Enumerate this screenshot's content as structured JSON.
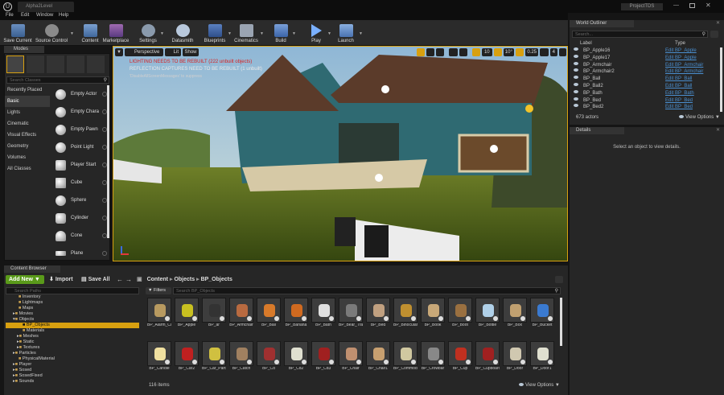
{
  "app": {
    "level_tab": "Alpha2Level",
    "project": "ProjectTDS",
    "menu": [
      "File",
      "Edit",
      "Window",
      "Help"
    ]
  },
  "toolbar": {
    "save": "Save Current",
    "source_control": "Source Control",
    "content": "Content",
    "marketplace": "Marketplace",
    "settings": "Settings",
    "datasmith": "Datasmith",
    "blueprints": "Blueprints",
    "cinematics": "Cinematics",
    "build": "Build",
    "play": "Play",
    "launch": "Launch"
  },
  "modes": {
    "tab": "Modes",
    "search_placeholder": "Search Classes",
    "categories": [
      "Recently Placed",
      "Basic",
      "Lights",
      "Cinematic",
      "Visual Effects",
      "Geometry",
      "Volumes",
      "All Classes"
    ],
    "selected_category": "Basic",
    "classes": [
      "Empty Actor",
      "Empty Chara",
      "Empty Pawn",
      "Point Light",
      "Player Start",
      "Cube",
      "Sphere",
      "Cylinder",
      "Cone",
      "Plane"
    ]
  },
  "viewport": {
    "perspective": "Perspective",
    "lit": "Lit",
    "show": "Show",
    "warning1": "LIGHTING NEEDS TO BE REBUILT (222 unbuilt objects)",
    "warning2": "REFLECTION CAPTURES NEED TO BE REBUILT (1 unbuilt)",
    "warning3": "'DisableAllScreenMessages' to suppress",
    "grid_snap": "10",
    "rot_snap": "10°",
    "scale_snap": "0.25",
    "cam_speed": "4"
  },
  "outliner": {
    "tab": "World Outliner",
    "search_placeholder": "Search...",
    "col_label": "Label",
    "col_type": "Type",
    "rows": [
      {
        "label": "BP_Apple16",
        "type": "Edit BP_Apple"
      },
      {
        "label": "BP_Apple17",
        "type": "Edit BP_Apple"
      },
      {
        "label": "BP_Armchair",
        "type": "Edit BP_Armchair"
      },
      {
        "label": "BP_Armchair2",
        "type": "Edit BP_Armchair"
      },
      {
        "label": "BP_Ball",
        "type": "Edit BP_Ball"
      },
      {
        "label": "BP_Ball2",
        "type": "Edit BP_Ball"
      },
      {
        "label": "BP_Bath",
        "type": "Edit BP_Bath"
      },
      {
        "label": "BP_Bed",
        "type": "Edit BP_Bed"
      },
      {
        "label": "BP_Bed2",
        "type": "Edit BP_Bed"
      }
    ],
    "actor_count": "673 actors",
    "view_options": "View Options"
  },
  "details": {
    "tab": "Details",
    "empty_msg": "Select an object to view details."
  },
  "content_browser": {
    "tab": "Content Browser",
    "add_new": "Add New",
    "import": "Import",
    "save_all": "Save All",
    "breadcrumb": [
      "Content",
      "Objects",
      "BP_Objects"
    ],
    "search_paths_placeholder": "Search Paths",
    "filters": "Filters",
    "search_placeholder": "Search BP_Objects",
    "tree": [
      {
        "name": "Inventory",
        "depth": 1
      },
      {
        "name": "Lightmaps",
        "depth": 1
      },
      {
        "name": "Maps",
        "depth": 1
      },
      {
        "name": "Movies",
        "depth": 1
      },
      {
        "name": "Objects",
        "depth": 1
      },
      {
        "name": "BP_Objects",
        "depth": 2
      },
      {
        "name": "Materials",
        "depth": 2
      },
      {
        "name": "Meshes",
        "depth": 2
      },
      {
        "name": "Static",
        "depth": 2
      },
      {
        "name": "Textures",
        "depth": 2
      },
      {
        "name": "Particles",
        "depth": 1
      },
      {
        "name": "PhysicalMaterial",
        "depth": 1
      },
      {
        "name": "Player",
        "depth": 1
      },
      {
        "name": "Sosed",
        "depth": 1
      },
      {
        "name": "SosedFixed",
        "depth": 1
      },
      {
        "name": "Sounds",
        "depth": 1
      }
    ],
    "selected_folder": "BP_Objects",
    "assets_row1": [
      "BP_Alarm_Clock",
      "BP_Apple",
      "BP_ar",
      "BP_Armchair",
      "BP_Ball",
      "BP_Banana",
      "BP_Bath",
      "BP_Bear_Trap",
      "BP_Bed",
      "BP_Binoculars",
      "BP_Book",
      "BP_Boot",
      "BP_Bottle",
      "BP_Box",
      "BP_Bucket"
    ],
    "assets_row2": [
      "BP_Candle",
      "BP_Car2",
      "BP_Car_Parts",
      "BP_Catch",
      "BP_Cd",
      "BP_Cd2",
      "BP_Cd3",
      "BP_Chair",
      "BP_Chair1",
      "BP_Commode",
      "BP_Crowbar",
      "BP_Cup",
      "BP_Cupboard_Broken",
      "BP_Door",
      "BP_Door1"
    ],
    "item_count": "116 items",
    "view_options": "View Options"
  },
  "colors": {
    "accent_orange": "#d8a010",
    "selection_blue": "#2a6ea8",
    "add_new_green": "#5a9a1a",
    "link_blue": "#4a8fd0"
  }
}
